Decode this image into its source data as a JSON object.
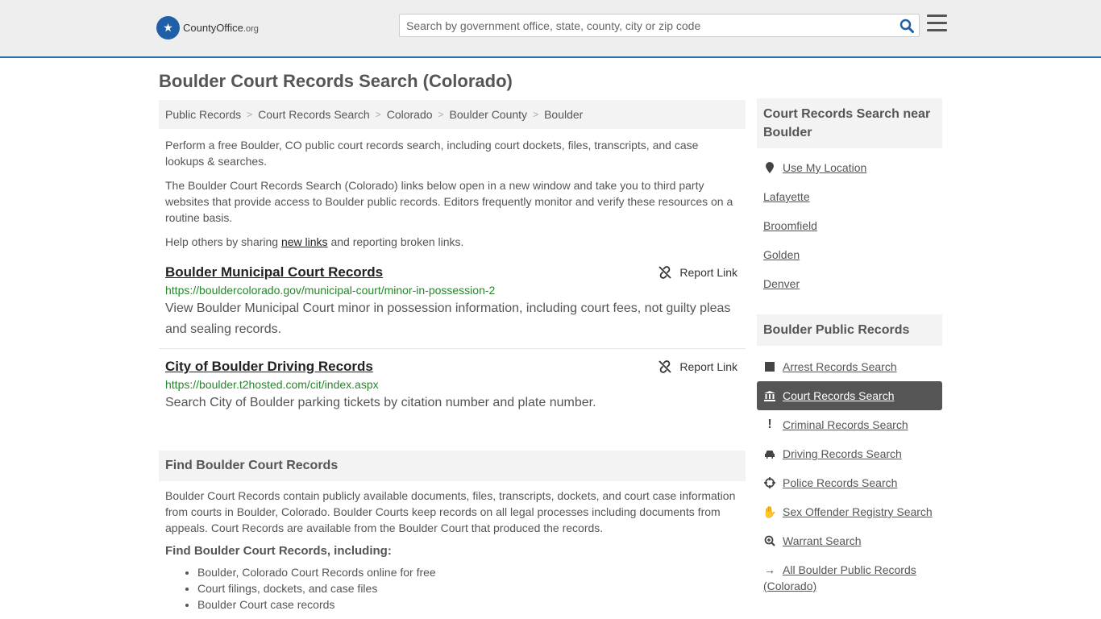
{
  "header": {
    "logo_main": "CountyOffice",
    "logo_tld": ".org",
    "search_placeholder": "Search by government office, state, county, city or zip code",
    "search_value": ""
  },
  "page_title": "Boulder Court Records Search (Colorado)",
  "breadcrumb": [
    "Public Records",
    "Court Records Search",
    "Colorado",
    "Boulder County",
    "Boulder"
  ],
  "intro": {
    "p1": "Perform a free Boulder, CO public court records search, including court dockets, files, transcripts, and case lookups & searches.",
    "p2": "The Boulder Court Records Search (Colorado) links below open in a new window and take you to third party websites that provide access to Boulder public records. Editors frequently monitor and verify these resources on a routine basis.",
    "p3_before": "Help others by sharing ",
    "p3_link": "new links",
    "p3_after": " and reporting broken links."
  },
  "links": [
    {
      "title": "Boulder Municipal Court Records",
      "url": "https://bouldercolorado.gov/municipal-court/minor-in-possession-2",
      "description": "View Boulder Municipal Court minor in possession information, including court fees, not guilty pleas and sealing records.",
      "report_label": "Report Link"
    },
    {
      "title": "City of Boulder Driving Records",
      "url": "https://boulder.t2hosted.com/cit/index.aspx",
      "description": "Search City of Boulder parking tickets by citation number and plate number.",
      "report_label": "Report Link"
    }
  ],
  "find_section": {
    "heading": "Find Boulder Court Records",
    "body": "Boulder Court Records contain publicly available documents, files, transcripts, dockets, and court case information from courts in Boulder, Colorado. Boulder Courts keep records on all legal processes including documents from appeals. Court Records are available from the Boulder Court that produced the records.",
    "sub_heading": "Find Boulder Court Records, including:",
    "bullets": [
      "Boulder, Colorado Court Records online for free",
      "Court filings, dockets, and case files",
      "Boulder Court case records"
    ]
  },
  "sidebar": {
    "near_heading": "Court Records Search near Boulder",
    "near_items": [
      {
        "label": "Use My Location",
        "icon": "map-marker-icon"
      },
      {
        "label": "Lafayette"
      },
      {
        "label": "Broomfield"
      },
      {
        "label": "Golden"
      },
      {
        "label": "Denver"
      }
    ],
    "public_heading": "Boulder Public Records",
    "public_items": [
      {
        "label": "Arrest Records Search",
        "icon": "square-icon",
        "active": false
      },
      {
        "label": "Court Records Search",
        "icon": "courthouse-icon",
        "active": true
      },
      {
        "label": "Criminal Records Search",
        "icon": "exclamation-icon",
        "active": false
      },
      {
        "label": "Driving Records Search",
        "icon": "car-icon",
        "active": false
      },
      {
        "label": "Police Records Search",
        "icon": "crosshairs-icon",
        "active": false
      },
      {
        "label": "Sex Offender Registry Search",
        "icon": "hand-icon",
        "active": false
      },
      {
        "label": "Warrant Search",
        "icon": "search-plus-icon",
        "active": false
      },
      {
        "label": "All Boulder Public Records (Colorado)",
        "icon": "arrow-right-icon",
        "active": false
      }
    ]
  }
}
